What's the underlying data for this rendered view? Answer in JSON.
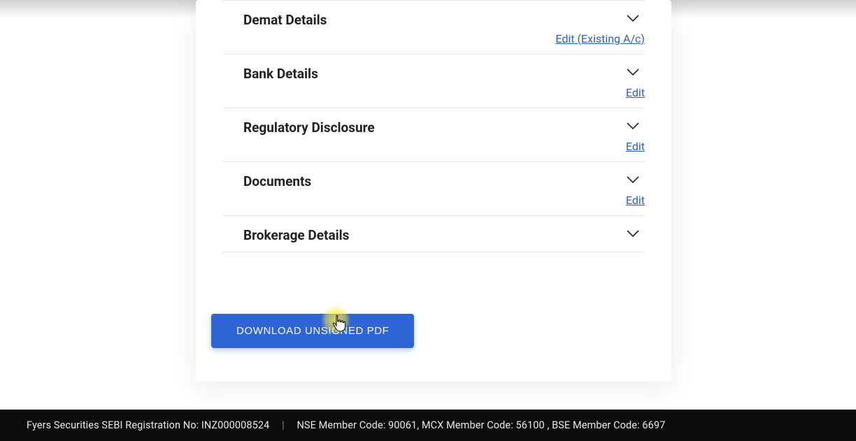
{
  "sections": [
    {
      "title": "Demat Details",
      "link_text": "Edit (Existing A/c)"
    },
    {
      "title": "Bank Details",
      "link_text": "Edit"
    },
    {
      "title": "Regulatory Disclosure",
      "link_text": "Edit"
    },
    {
      "title": "Documents",
      "link_text": "Edit"
    },
    {
      "title": "Brokerage Details",
      "link_text": ""
    }
  ],
  "buttons": {
    "download_label": "DOWNLOAD UNSIGNED PDF"
  },
  "footer": {
    "sebi": "Fyers Securities SEBI Registration No: INZ000008524",
    "sep": "|",
    "codes": "NSE Member Code: 90061, MCX Member Code: 56100 , BSE Member Code: 6697"
  }
}
